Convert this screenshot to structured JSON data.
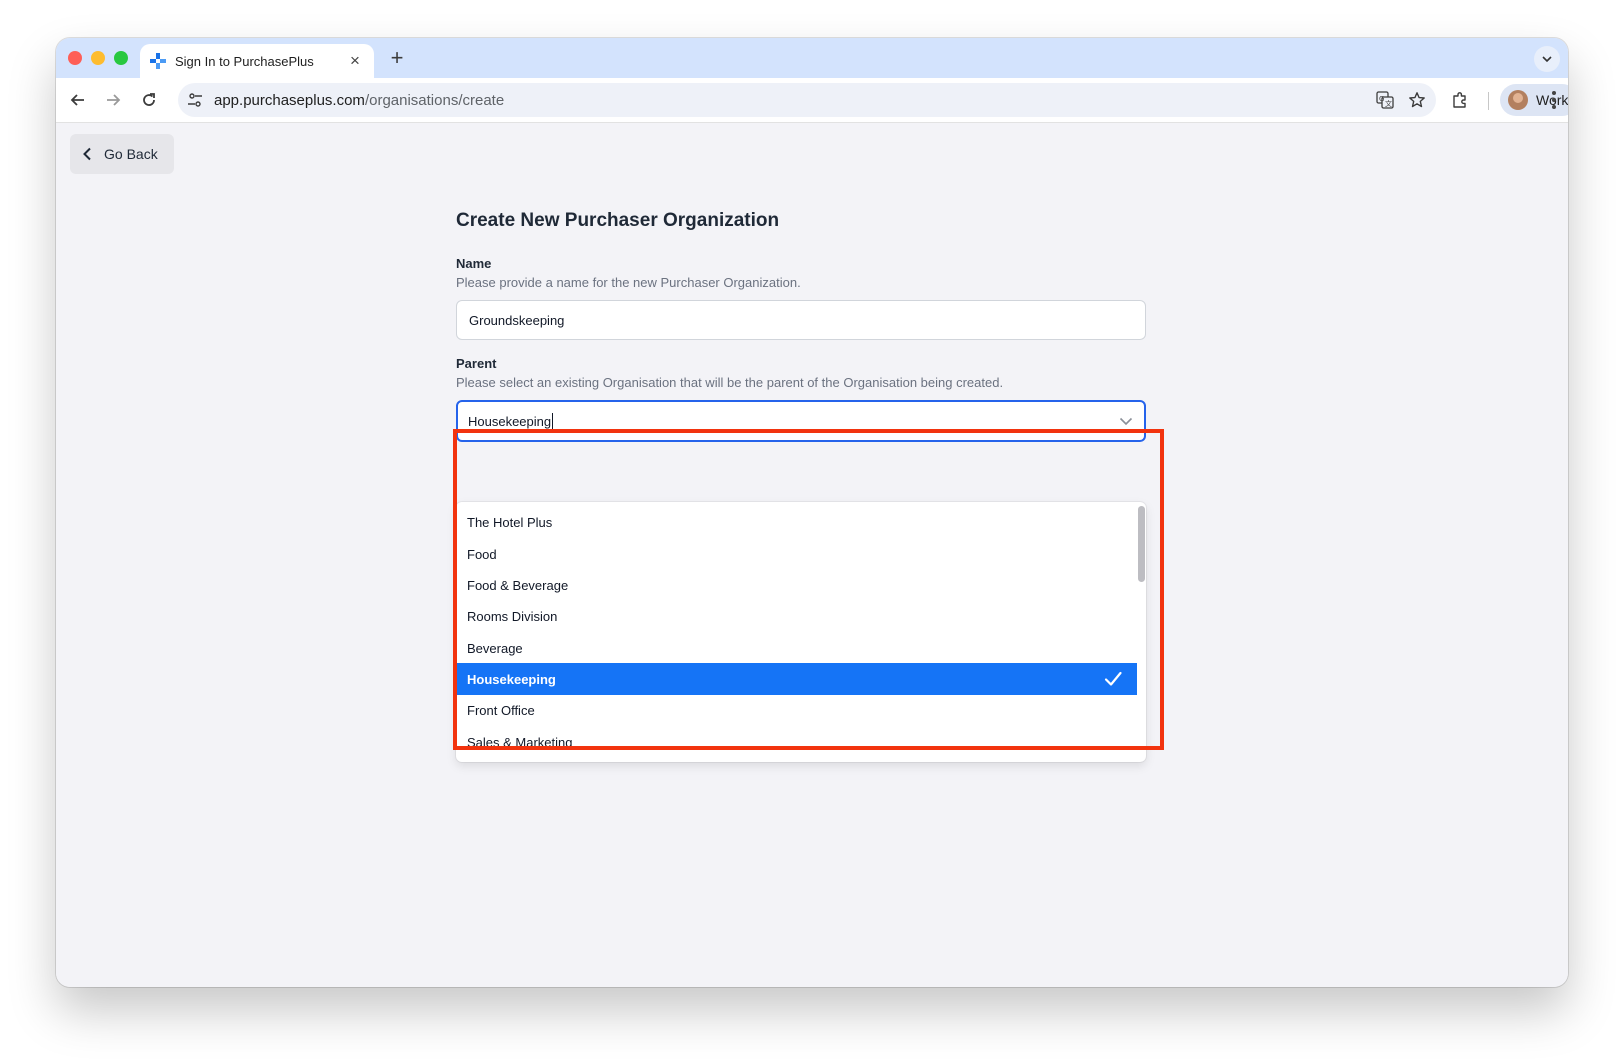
{
  "browser": {
    "tab_title": "Sign In to PurchasePlus",
    "url_host": "app.purchaseplus.com",
    "url_path": "/organisations/create",
    "profile_name": "Work",
    "icons": {
      "back": "arrow-left-icon",
      "forward": "arrow-right-icon",
      "reload": "reload-icon",
      "site_info": "tune-icon",
      "translate": "translate-icon",
      "bookmark": "star-icon",
      "extensions": "puzzle-icon",
      "menu": "kebab-menu-icon"
    }
  },
  "page": {
    "go_back_label": "Go Back",
    "title": "Create New Purchaser Organization",
    "name_field": {
      "label": "Name",
      "help": "Please provide a name for the new Purchaser Organization.",
      "value": "Groundskeeping"
    },
    "parent_field": {
      "label": "Parent",
      "help": "Please select an existing Organisation that will be the parent of the Organisation being created.",
      "value": "Housekeeping",
      "options": [
        {
          "label": "The Hotel Plus",
          "selected": false
        },
        {
          "label": "Food",
          "selected": false
        },
        {
          "label": "Food & Beverage",
          "selected": false
        },
        {
          "label": "Rooms Division",
          "selected": false
        },
        {
          "label": "Beverage",
          "selected": false
        },
        {
          "label": "Housekeeping",
          "selected": true
        },
        {
          "label": "Front Office",
          "selected": false
        },
        {
          "label": "Sales & Marketing",
          "selected": false
        }
      ]
    }
  },
  "colors": {
    "accent": "#1574f6",
    "focus_border": "#2563eb",
    "annotation": "#f2330e"
  }
}
